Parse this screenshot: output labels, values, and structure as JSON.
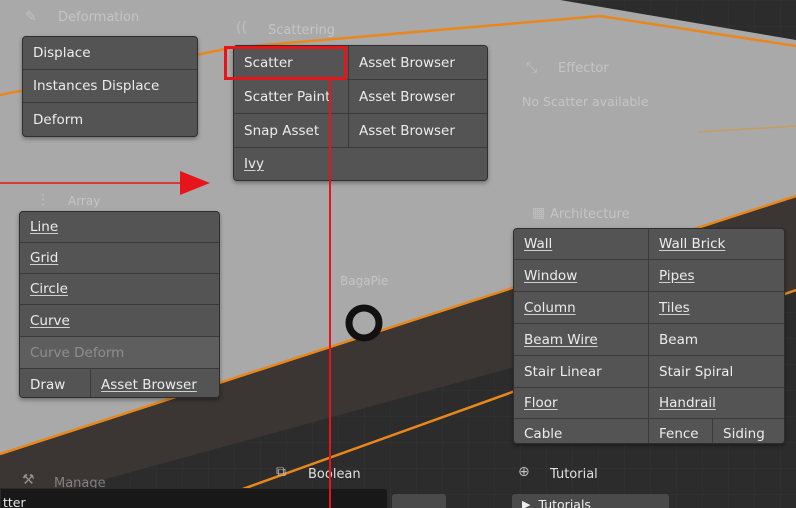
{
  "panels": {
    "deformation": {
      "title": "Deformation",
      "items": [
        "Displace",
        "Instances Displace",
        "Deform"
      ]
    },
    "scattering": {
      "title": "Scattering",
      "rows": [
        [
          "Scatter",
          "Asset Browser"
        ],
        [
          "Scatter Paint",
          "Asset Browser"
        ],
        [
          "Snap Asset",
          "Asset Browser"
        ],
        [
          "Ivy"
        ]
      ],
      "highlighted": "Scatter"
    },
    "effector": {
      "title": "Effector",
      "message": "No Scatter available"
    },
    "array": {
      "title": "Array",
      "items": [
        "Line",
        "Grid",
        "Circle",
        "Curve"
      ],
      "curve_deform": "Curve Deform",
      "draw": "Draw",
      "asset_browser": "Asset Browser"
    },
    "center": {
      "label": "BagaPie"
    },
    "architecture": {
      "title": "Architecture",
      "rows": [
        [
          "Wall",
          "Wall Brick"
        ],
        [
          "Window",
          "Pipes"
        ],
        [
          "Column",
          "Tiles"
        ],
        [
          "Beam Wire",
          "Beam"
        ],
        [
          "Stair Linear",
          "Stair Spiral"
        ],
        [
          "Floor",
          "Handrail"
        ],
        [
          "Cable",
          "Fence",
          "Siding"
        ]
      ]
    },
    "manage": {
      "title": "Manage"
    },
    "boolean": {
      "title": "Boolean"
    },
    "tutorial": {
      "title": "Tutorial",
      "button": "Tutorials"
    }
  },
  "tooltip": {
    "text": "tter"
  },
  "colors": {
    "highlight": "#e8141c",
    "arrow": "#e8141c",
    "orange_edge": "#e8871c",
    "button": "#545454",
    "panel": "#4a4a4a"
  },
  "icons": [
    "deformation-icon",
    "scattering-icon",
    "effector-icon",
    "array-icon",
    "architecture-icon",
    "manage-icon",
    "boolean-icon",
    "tutorial-globe-icon",
    "play-icon"
  ]
}
